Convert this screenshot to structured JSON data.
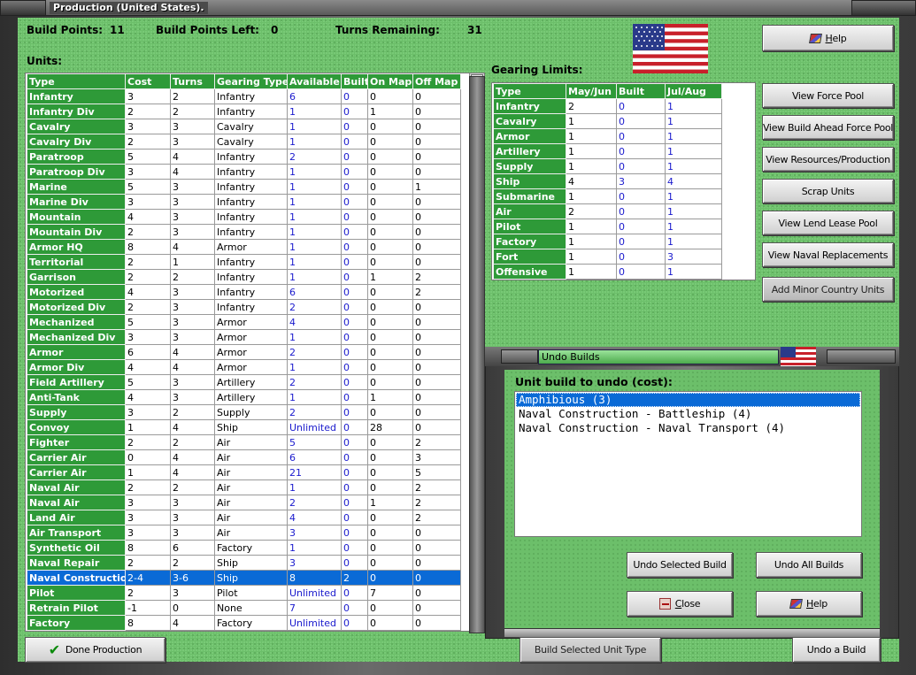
{
  "window": {
    "title": "Production (United States)."
  },
  "summary": {
    "build_points_label": "Build Points:",
    "build_points": "11",
    "build_points_left_label": "Build Points Left:",
    "build_points_left": "0",
    "turns_remaining_label": "Turns Remaining:",
    "turns_remaining": "31"
  },
  "units": {
    "heading": "Units:",
    "columns": [
      "Type",
      "Cost",
      "Turns",
      "Gearing Type",
      "Available",
      "Built",
      "On Map",
      "Off Map"
    ],
    "rows": [
      [
        "Infantry",
        "3",
        "2",
        "Infantry",
        "6",
        "0",
        "0",
        "0"
      ],
      [
        "Infantry Div",
        "2",
        "2",
        "Infantry",
        "1",
        "0",
        "1",
        "0"
      ],
      [
        "Cavalry",
        "3",
        "3",
        "Cavalry",
        "1",
        "0",
        "0",
        "0"
      ],
      [
        "Cavalry Div",
        "2",
        "3",
        "Cavalry",
        "1",
        "0",
        "0",
        "0"
      ],
      [
        "Paratroop",
        "5",
        "4",
        "Infantry",
        "2",
        "0",
        "0",
        "0"
      ],
      [
        "Paratroop Div",
        "3",
        "4",
        "Infantry",
        "1",
        "0",
        "0",
        "0"
      ],
      [
        "Marine",
        "5",
        "3",
        "Infantry",
        "1",
        "0",
        "0",
        "1"
      ],
      [
        "Marine Div",
        "3",
        "3",
        "Infantry",
        "1",
        "0",
        "0",
        "0"
      ],
      [
        "Mountain",
        "4",
        "3",
        "Infantry",
        "1",
        "0",
        "0",
        "0"
      ],
      [
        "Mountain Div",
        "2",
        "3",
        "Infantry",
        "1",
        "0",
        "0",
        "0"
      ],
      [
        "Armor HQ",
        "8",
        "4",
        "Armor",
        "1",
        "0",
        "0",
        "0"
      ],
      [
        "Territorial",
        "2",
        "1",
        "Infantry",
        "1",
        "0",
        "0",
        "0"
      ],
      [
        "Garrison",
        "2",
        "2",
        "Infantry",
        "1",
        "0",
        "1",
        "2"
      ],
      [
        "Motorized",
        "4",
        "3",
        "Infantry",
        "6",
        "0",
        "0",
        "2"
      ],
      [
        "Motorized Div",
        "2",
        "3",
        "Infantry",
        "2",
        "0",
        "0",
        "0"
      ],
      [
        "Mechanized",
        "5",
        "3",
        "Armor",
        "4",
        "0",
        "0",
        "0"
      ],
      [
        "Mechanized Div",
        "3",
        "3",
        "Armor",
        "1",
        "0",
        "0",
        "0"
      ],
      [
        "Armor",
        "6",
        "4",
        "Armor",
        "2",
        "0",
        "0",
        "0"
      ],
      [
        "Armor Div",
        "4",
        "4",
        "Armor",
        "1",
        "0",
        "0",
        "0"
      ],
      [
        "Field Artillery",
        "5",
        "3",
        "Artillery",
        "2",
        "0",
        "0",
        "0"
      ],
      [
        "Anti-Tank",
        "4",
        "3",
        "Artillery",
        "1",
        "0",
        "1",
        "0"
      ],
      [
        "Supply",
        "3",
        "2",
        "Supply",
        "2",
        "0",
        "0",
        "0"
      ],
      [
        "Convoy",
        "1",
        "4",
        "Ship",
        "Unlimited",
        "0",
        "28",
        "0"
      ],
      [
        "Fighter",
        "2",
        "2",
        "Air",
        "5",
        "0",
        "0",
        "2"
      ],
      [
        "Carrier Air",
        "0",
        "4",
        "Air",
        "6",
        "0",
        "0",
        "3"
      ],
      [
        "Carrier Air",
        "1",
        "4",
        "Air",
        "21",
        "0",
        "0",
        "5"
      ],
      [
        "Naval Air",
        "2",
        "2",
        "Air",
        "1",
        "0",
        "0",
        "2"
      ],
      [
        "Naval Air",
        "3",
        "3",
        "Air",
        "2",
        "0",
        "1",
        "2"
      ],
      [
        "Land Air",
        "3",
        "3",
        "Air",
        "4",
        "0",
        "0",
        "2"
      ],
      [
        "Air Transport",
        "3",
        "3",
        "Air",
        "3",
        "0",
        "0",
        "0"
      ],
      [
        "Synthetic Oil",
        "8",
        "6",
        "Factory",
        "1",
        "0",
        "0",
        "0"
      ],
      [
        "Naval Repair",
        "2",
        "2",
        "Ship",
        "3",
        "0",
        "0",
        "0"
      ],
      [
        "Naval Construction",
        "2-4",
        "3-6",
        "Ship",
        "8",
        "2",
        "0",
        "0"
      ],
      [
        "Pilot",
        "2",
        "3",
        "Pilot",
        "Unlimited",
        "0",
        "7",
        "0"
      ],
      [
        "Retrain Pilot",
        "-1",
        "0",
        "None",
        "7",
        "0",
        "0",
        "0"
      ],
      [
        "Factory",
        "8",
        "4",
        "Factory",
        "Unlimited",
        "0",
        "0",
        "0"
      ]
    ],
    "selected_row": "Naval Construction"
  },
  "gearing": {
    "heading": "Gearing Limits:",
    "columns": [
      "Type",
      "May/Jun",
      "Built",
      "Jul/Aug"
    ],
    "rows": [
      [
        "Infantry",
        "2",
        "0",
        "1"
      ],
      [
        "Cavalry",
        "1",
        "0",
        "1"
      ],
      [
        "Armor",
        "1",
        "0",
        "1"
      ],
      [
        "Artillery",
        "1",
        "0",
        "1"
      ],
      [
        "Supply",
        "1",
        "0",
        "1"
      ],
      [
        "Ship",
        "4",
        "3",
        "4"
      ],
      [
        "Submarine",
        "1",
        "0",
        "1"
      ],
      [
        "Air",
        "2",
        "0",
        "1"
      ],
      [
        "Pilot",
        "1",
        "0",
        "1"
      ],
      [
        "Factory",
        "1",
        "0",
        "1"
      ],
      [
        "Fort",
        "1",
        "0",
        "3"
      ],
      [
        "Offensive",
        "1",
        "0",
        "1"
      ]
    ]
  },
  "side_buttons": {
    "help": "Help",
    "force_pool": "View Force Pool",
    "build_ahead": "View Build Ahead Force Pool",
    "resources": "View Resources/Production",
    "scrap": "Scrap Units",
    "lend_lease": "View Lend Lease Pool",
    "naval_repl": "View Naval Replacements",
    "minor": "Add Minor Country Units"
  },
  "undo": {
    "title": "Undo Builds",
    "heading": "Unit build to undo (cost):",
    "items": [
      "Amphibious (3)",
      "Naval Construction - Battleship (4)",
      "Naval Construction - Naval Transport (4)"
    ],
    "undo_selected": "Undo Selected Build",
    "undo_all": "Undo All Builds",
    "close": "Close",
    "help": "Help"
  },
  "bottom": {
    "done": "Done Production",
    "build_selected": "Build Selected Unit Type",
    "undo_build": "Undo a Build"
  },
  "colors": {
    "felt": "#6cbf6a",
    "header_green": "#2e9a38",
    "selection": "#0a6ad6",
    "blue_value": "#1a1acd"
  },
  "icons": {
    "flag": "us-flag-icon",
    "help": "help-book-icon",
    "close": "close-door-icon",
    "done": "checkmark-icon"
  }
}
